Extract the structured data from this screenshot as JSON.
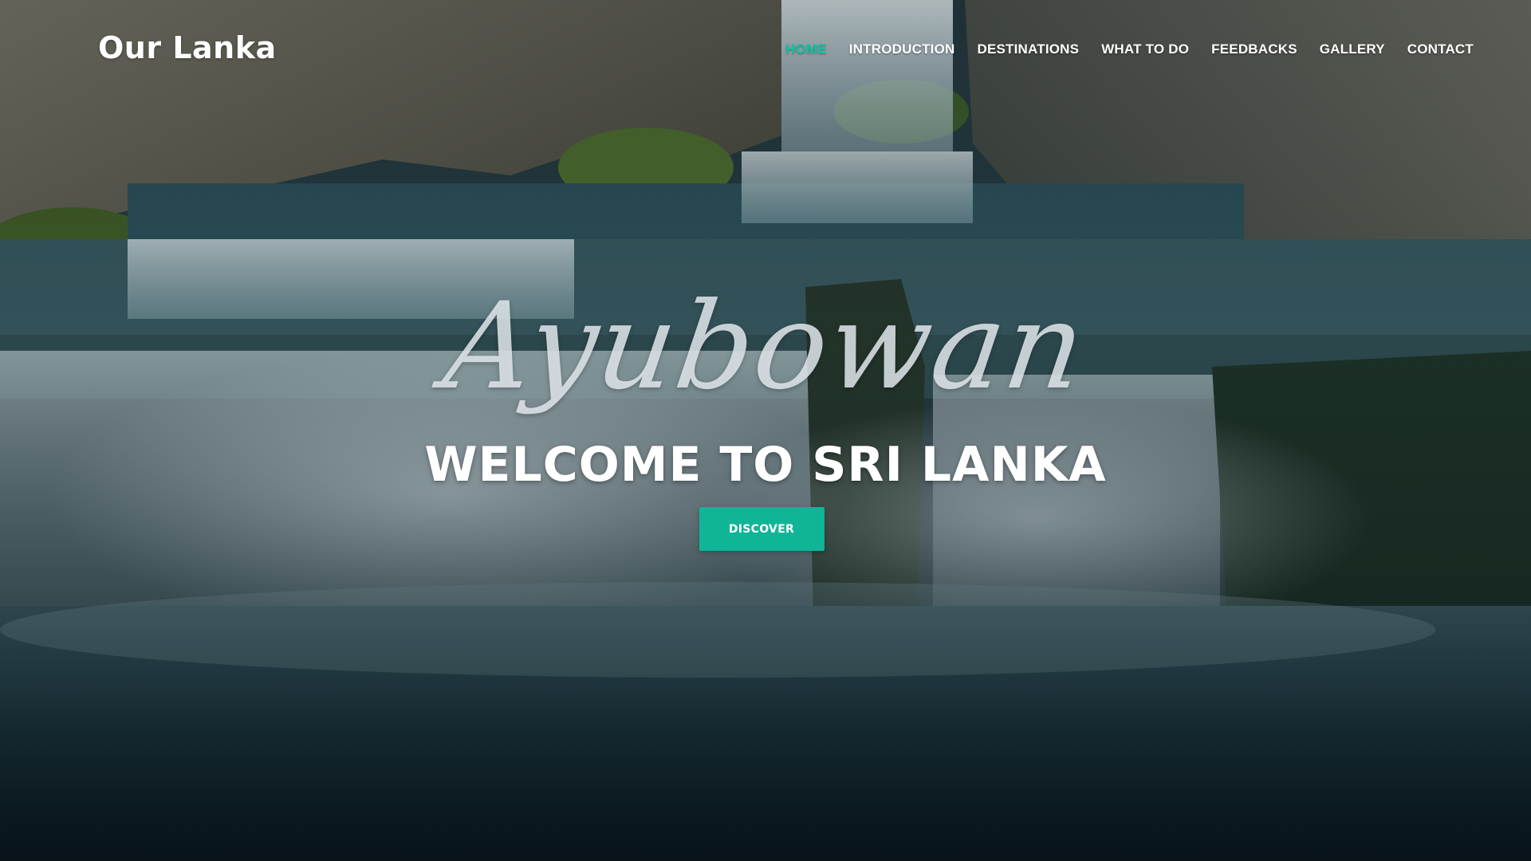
{
  "brand": {
    "name": "Our Lanka"
  },
  "nav": {
    "items": [
      {
        "label": "HOME",
        "active": true
      },
      {
        "label": "INTRODUCTION",
        "active": false
      },
      {
        "label": "DESTINATIONS",
        "active": false
      },
      {
        "label": "WHAT TO DO",
        "active": false
      },
      {
        "label": "FEEDBACKS",
        "active": false
      },
      {
        "label": "GALLERY",
        "active": false
      },
      {
        "label": "CONTACT",
        "active": false
      }
    ]
  },
  "hero": {
    "script_title": "Ayubowan",
    "heading": "WELCOME TO SRI LANKA",
    "button_label": "DISCOVER",
    "background_image": "waterfall-photo"
  },
  "colors": {
    "accent": "#13c2a3",
    "button": "#10b597",
    "text": "#ffffff"
  }
}
